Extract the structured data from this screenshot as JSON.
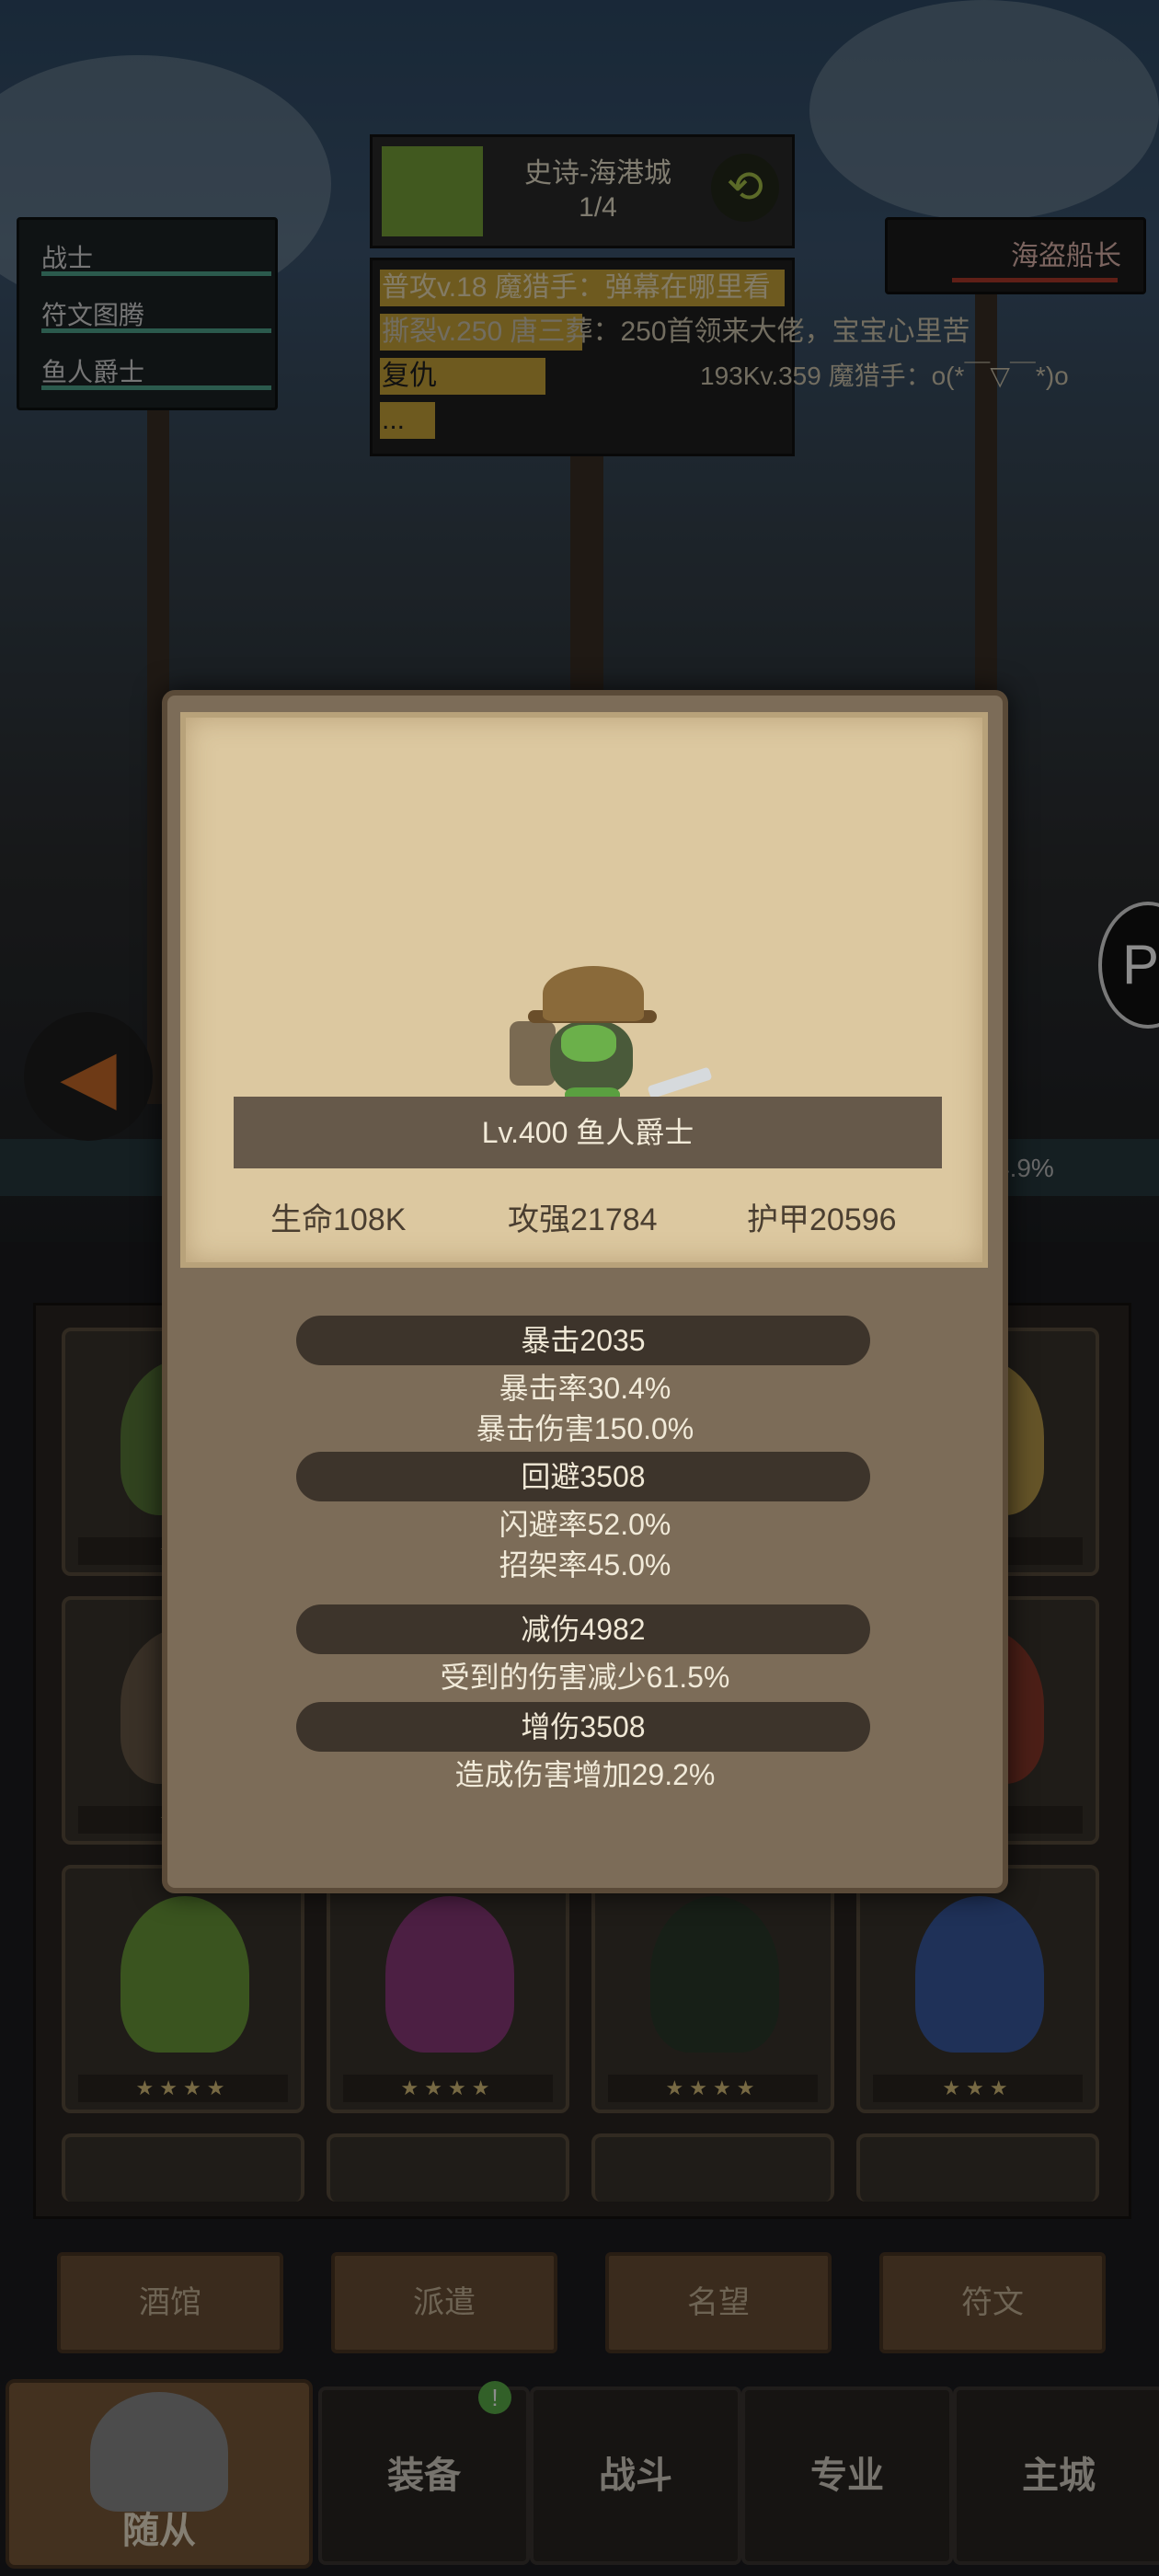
{
  "stage": {
    "title": "史诗-海港城",
    "progress": "1/4",
    "refresh_icon": "refresh-icon"
  },
  "chat": [
    {
      "text": "普攻v.18 魔猎手：弹幕在哪里看"
    },
    {
      "text": "撕裂v.250 唐三葬：250首领来大佬，宝宝心里苦"
    },
    {
      "text": "复仇"
    },
    {
      "text": "..."
    },
    {
      "text": "193Kv.359 魔猎手：o(*￣▽￣*)o"
    }
  ],
  "team": {
    "items": [
      "战士",
      "符文图腾",
      "鱼人爵士"
    ]
  },
  "boss": {
    "name": "海盗船长"
  },
  "percent": "4.9%",
  "modal": {
    "hero_name": "Lv.400 鱼人爵士",
    "stats": [
      {
        "label": "生命108K"
      },
      {
        "label": "攻强21784"
      },
      {
        "label": "护甲20596"
      }
    ],
    "sections": [
      {
        "title": "暴击2035",
        "lines": [
          "暴击率30.4%",
          "暴击伤害150.0%"
        ]
      },
      {
        "title": "回避3508",
        "lines": [
          "闪避率52.0%",
          "招架率45.0%"
        ]
      },
      {
        "title": "减伤4982",
        "lines": [
          "受到的伤害减少61.5%"
        ]
      },
      {
        "title": "增伤3508",
        "lines": [
          "造成伤害增加29.2%"
        ]
      }
    ]
  },
  "grid": {
    "cards": [
      {
        "stars": "★★"
      },
      {
        "stars": ""
      },
      {
        "stars": ""
      },
      {
        "stars": "★★"
      },
      {
        "stars": "★★"
      },
      {
        "stars": ""
      },
      {
        "stars": ""
      },
      {
        "stars": "★★"
      },
      {
        "stars": "★★★★"
      },
      {
        "stars": "★★★★"
      },
      {
        "stars": "★★★★"
      },
      {
        "stars": "★★★"
      }
    ]
  },
  "tabs": [
    "酒馆",
    "派遣",
    "名望",
    "符文"
  ],
  "nav": {
    "follower": "随从",
    "equip": "装备",
    "battle": "战斗",
    "pro": "专业",
    "city": "主城",
    "badge": "!"
  },
  "colors": {
    "parchment": "#dcc8a0",
    "panel": "#7c6c58",
    "accent_green": "#77a33a"
  }
}
